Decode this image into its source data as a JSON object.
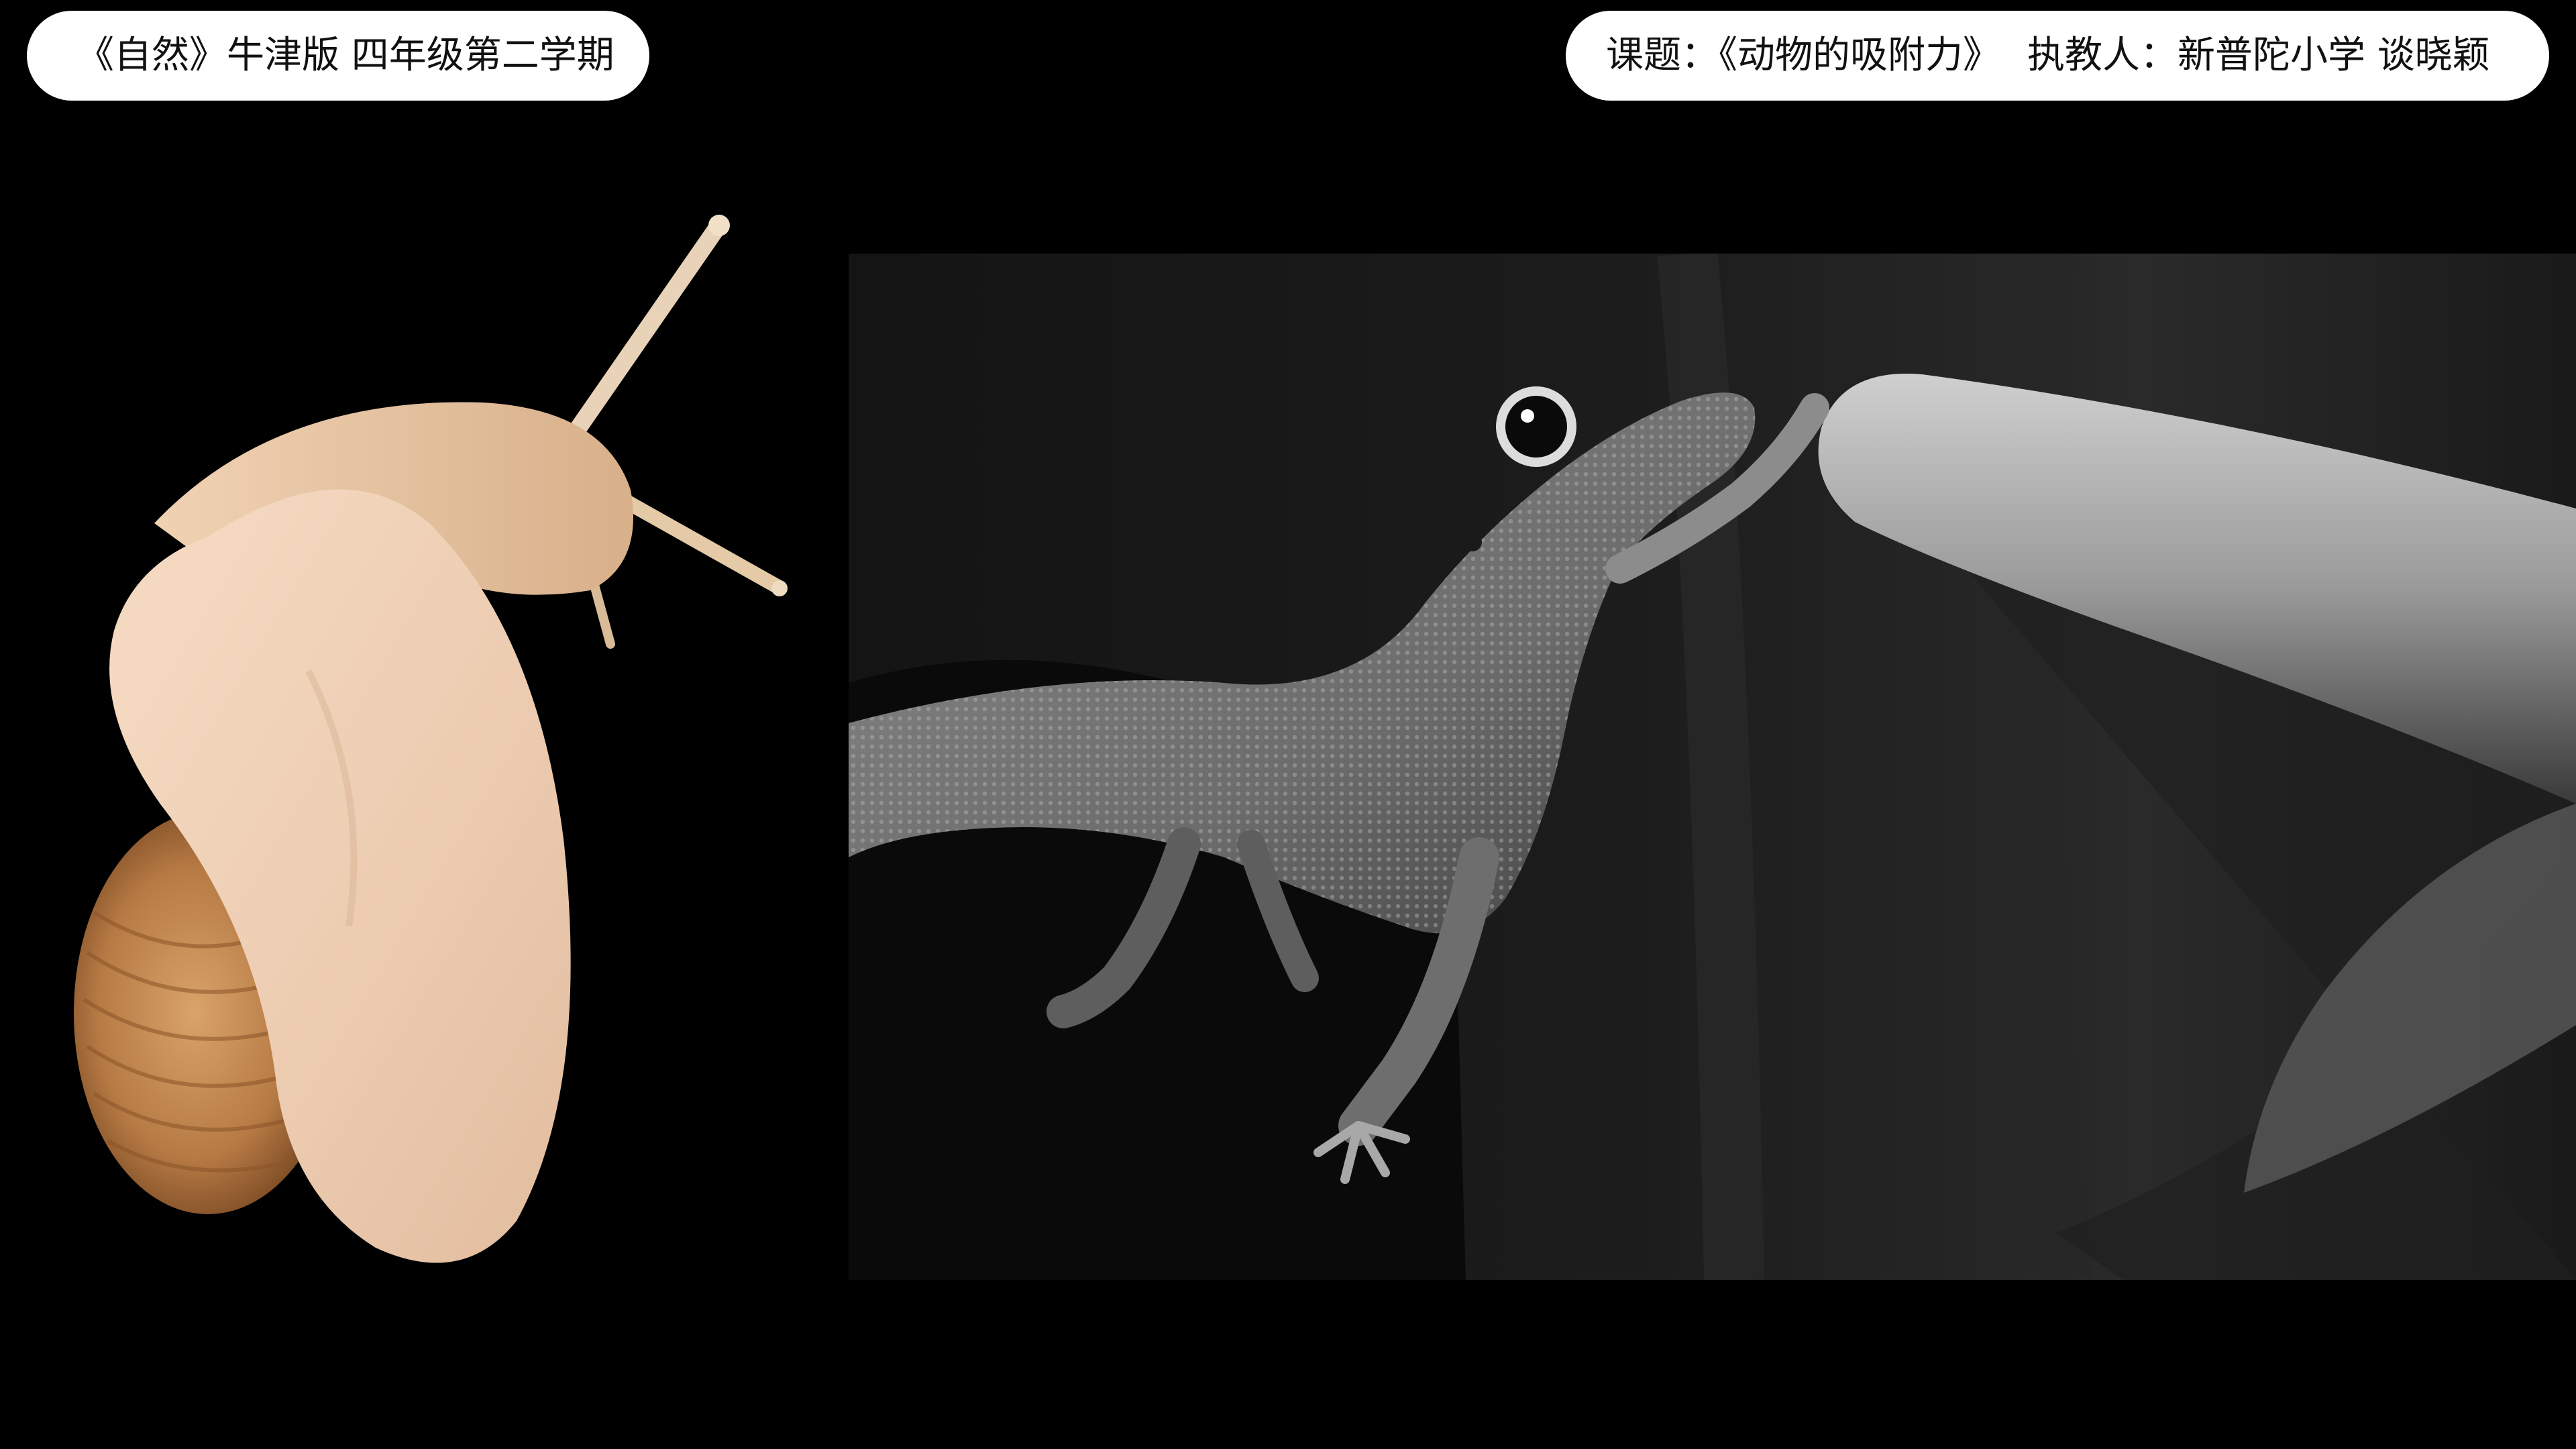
{
  "header": {
    "course_label": "《自然》牛津版 四年级第二学期",
    "topic_label": "课题：《动物的吸附力》",
    "teacher_label": "执教人：新普陀小学 谈晓颖"
  },
  "images": {
    "snail": "snail-photo",
    "gecko": "gecko-on-finger-photo"
  },
  "colors": {
    "background": "#000000",
    "pill": "#ffffff",
    "snail_body": "#efd2b6",
    "snail_shell": "#c08850"
  }
}
